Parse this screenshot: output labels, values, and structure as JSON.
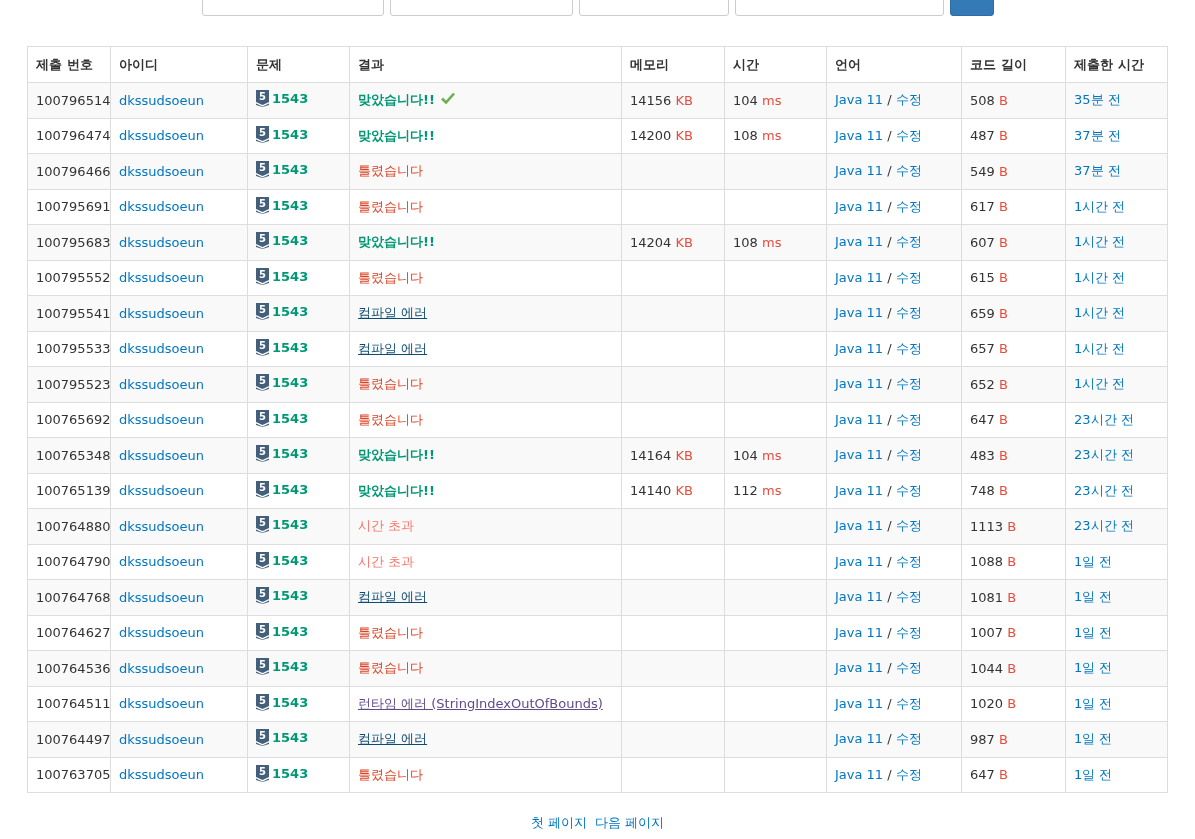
{
  "table": {
    "columns": [
      "제출 번호",
      "아이디",
      "문제",
      "결과",
      "메모리",
      "시간",
      "언어",
      "코드 길이",
      "제출한 시간"
    ],
    "rows": [
      {
        "id": "100796514",
        "user": "dkssudsoeun",
        "tier": "5",
        "problem": "1543",
        "result": "맞았습니다!!",
        "kind": "ac",
        "check": true,
        "memory": "14156",
        "memory_unit": "KB",
        "time": "104",
        "time_unit": "ms",
        "language": "Java 11",
        "separator": "/",
        "edit": "수정",
        "length": "508",
        "length_unit": "B",
        "submitted": "35분 전"
      },
      {
        "id": "100796474",
        "user": "dkssudsoeun",
        "tier": "5",
        "problem": "1543",
        "result": "맞았습니다!!",
        "kind": "ac",
        "check": false,
        "memory": "14200",
        "memory_unit": "KB",
        "time": "108",
        "time_unit": "ms",
        "language": "Java 11",
        "separator": "/",
        "edit": "수정",
        "length": "487",
        "length_unit": "B",
        "submitted": "37분 전"
      },
      {
        "id": "100796466",
        "user": "dkssudsoeun",
        "tier": "5",
        "problem": "1543",
        "result": "틀렸습니다",
        "kind": "wa",
        "check": false,
        "language": "Java 11",
        "separator": "/",
        "edit": "수정",
        "length": "549",
        "length_unit": "B",
        "submitted": "37분 전"
      },
      {
        "id": "100795691",
        "user": "dkssudsoeun",
        "tier": "5",
        "problem": "1543",
        "result": "틀렸습니다",
        "kind": "wa",
        "check": false,
        "language": "Java 11",
        "separator": "/",
        "edit": "수정",
        "length": "617",
        "length_unit": "B",
        "submitted": "1시간 전"
      },
      {
        "id": "100795683",
        "user": "dkssudsoeun",
        "tier": "5",
        "problem": "1543",
        "result": "맞았습니다!!",
        "kind": "ac",
        "check": false,
        "memory": "14204",
        "memory_unit": "KB",
        "time": "108",
        "time_unit": "ms",
        "language": "Java 11",
        "separator": "/",
        "edit": "수정",
        "length": "607",
        "length_unit": "B",
        "submitted": "1시간 전"
      },
      {
        "id": "100795552",
        "user": "dkssudsoeun",
        "tier": "5",
        "problem": "1543",
        "result": "틀렸습니다",
        "kind": "wa",
        "check": false,
        "language": "Java 11",
        "separator": "/",
        "edit": "수정",
        "length": "615",
        "length_unit": "B",
        "submitted": "1시간 전"
      },
      {
        "id": "100795541",
        "user": "dkssudsoeun",
        "tier": "5",
        "problem": "1543",
        "result": "컴파일 에러",
        "kind": "ce",
        "check": false,
        "language": "Java 11",
        "separator": "/",
        "edit": "수정",
        "length": "659",
        "length_unit": "B",
        "submitted": "1시간 전"
      },
      {
        "id": "100795533",
        "user": "dkssudsoeun",
        "tier": "5",
        "problem": "1543",
        "result": "컴파일 에러",
        "kind": "ce",
        "check": false,
        "language": "Java 11",
        "separator": "/",
        "edit": "수정",
        "length": "657",
        "length_unit": "B",
        "submitted": "1시간 전"
      },
      {
        "id": "100795523",
        "user": "dkssudsoeun",
        "tier": "5",
        "problem": "1543",
        "result": "틀렸습니다",
        "kind": "wa",
        "check": false,
        "language": "Java 11",
        "separator": "/",
        "edit": "수정",
        "length": "652",
        "length_unit": "B",
        "submitted": "1시간 전"
      },
      {
        "id": "100765692",
        "user": "dkssudsoeun",
        "tier": "5",
        "problem": "1543",
        "result": "틀렸습니다",
        "kind": "wa",
        "check": false,
        "language": "Java 11",
        "separator": "/",
        "edit": "수정",
        "length": "647",
        "length_unit": "B",
        "submitted": "23시간 전"
      },
      {
        "id": "100765348",
        "user": "dkssudsoeun",
        "tier": "5",
        "problem": "1543",
        "result": "맞았습니다!!",
        "kind": "ac",
        "check": false,
        "memory": "14164",
        "memory_unit": "KB",
        "time": "104",
        "time_unit": "ms",
        "language": "Java 11",
        "separator": "/",
        "edit": "수정",
        "length": "483",
        "length_unit": "B",
        "submitted": "23시간 전"
      },
      {
        "id": "100765139",
        "user": "dkssudsoeun",
        "tier": "5",
        "problem": "1543",
        "result": "맞았습니다!!",
        "kind": "ac",
        "check": false,
        "memory": "14140",
        "memory_unit": "KB",
        "time": "112",
        "time_unit": "ms",
        "language": "Java 11",
        "separator": "/",
        "edit": "수정",
        "length": "748",
        "length_unit": "B",
        "submitted": "23시간 전"
      },
      {
        "id": "100764880",
        "user": "dkssudsoeun",
        "tier": "5",
        "problem": "1543",
        "result": "시간 초과",
        "kind": "tle",
        "check": false,
        "language": "Java 11",
        "separator": "/",
        "edit": "수정",
        "length": "1113",
        "length_unit": "B",
        "submitted": "23시간 전"
      },
      {
        "id": "100764790",
        "user": "dkssudsoeun",
        "tier": "5",
        "problem": "1543",
        "result": "시간 초과",
        "kind": "tle",
        "check": false,
        "language": "Java 11",
        "separator": "/",
        "edit": "수정",
        "length": "1088",
        "length_unit": "B",
        "submitted": "1일 전"
      },
      {
        "id": "100764768",
        "user": "dkssudsoeun",
        "tier": "5",
        "problem": "1543",
        "result": "컴파일 에러",
        "kind": "ce",
        "check": false,
        "language": "Java 11",
        "separator": "/",
        "edit": "수정",
        "length": "1081",
        "length_unit": "B",
        "submitted": "1일 전"
      },
      {
        "id": "100764627",
        "user": "dkssudsoeun",
        "tier": "5",
        "problem": "1543",
        "result": "틀렸습니다",
        "kind": "wa",
        "check": false,
        "language": "Java 11",
        "separator": "/",
        "edit": "수정",
        "length": "1007",
        "length_unit": "B",
        "submitted": "1일 전"
      },
      {
        "id": "100764536",
        "user": "dkssudsoeun",
        "tier": "5",
        "problem": "1543",
        "result": "틀렸습니다",
        "kind": "wa",
        "check": false,
        "language": "Java 11",
        "separator": "/",
        "edit": "수정",
        "length": "1044",
        "length_unit": "B",
        "submitted": "1일 전"
      },
      {
        "id": "100764511",
        "user": "dkssudsoeun",
        "tier": "5",
        "problem": "1543",
        "result": "런타임 에러 (StringIndexOutOfBounds)",
        "kind": "rte",
        "check": false,
        "language": "Java 11",
        "separator": "/",
        "edit": "수정",
        "length": "1020",
        "length_unit": "B",
        "submitted": "1일 전"
      },
      {
        "id": "100764497",
        "user": "dkssudsoeun",
        "tier": "5",
        "problem": "1543",
        "result": "컴파일 에러",
        "kind": "ce",
        "check": false,
        "language": "Java 11",
        "separator": "/",
        "edit": "수정",
        "length": "987",
        "length_unit": "B",
        "submitted": "1일 전"
      },
      {
        "id": "100763705",
        "user": "dkssudsoeun",
        "tier": "5",
        "problem": "1543",
        "result": "틀렸습니다",
        "kind": "wa",
        "check": false,
        "language": "Java 11",
        "separator": "/",
        "edit": "수정",
        "length": "647",
        "length_unit": "B",
        "submitted": "1일 전"
      }
    ]
  },
  "pagination": [
    "첫 페이지",
    "다음 페이지"
  ]
}
